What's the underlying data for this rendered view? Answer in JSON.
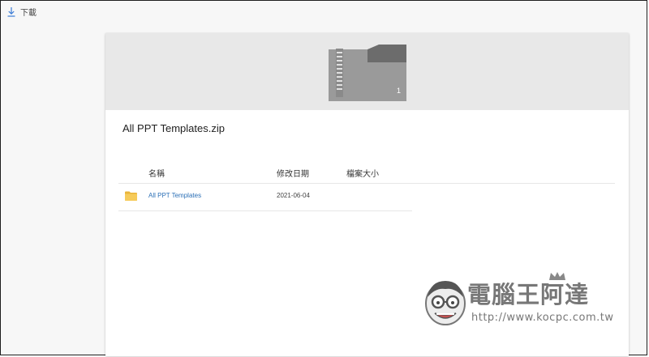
{
  "toolbar": {
    "download_label": "下載",
    "download_icon": "download-icon"
  },
  "archive": {
    "file_name": "All PPT Templates.zip",
    "thumbnail_icon": "zip-file-icon",
    "item_count": "1"
  },
  "table": {
    "columns": [
      "名稱",
      "修改日期",
      "檔案大小"
    ],
    "rows": [
      {
        "icon": "folder-icon",
        "name": "All PPT Templates",
        "modified": "2021-06-04",
        "size": ""
      }
    ]
  },
  "watermark": {
    "title": "電腦王阿達",
    "url": "http://www.kocpc.com.tw"
  },
  "colors": {
    "link": "#2b6fb6",
    "folder": "#f2c44f",
    "preview_bg": "#e8e8e8",
    "zip_body": "#9a9a9a",
    "zip_tab": "#6c6c6c"
  }
}
